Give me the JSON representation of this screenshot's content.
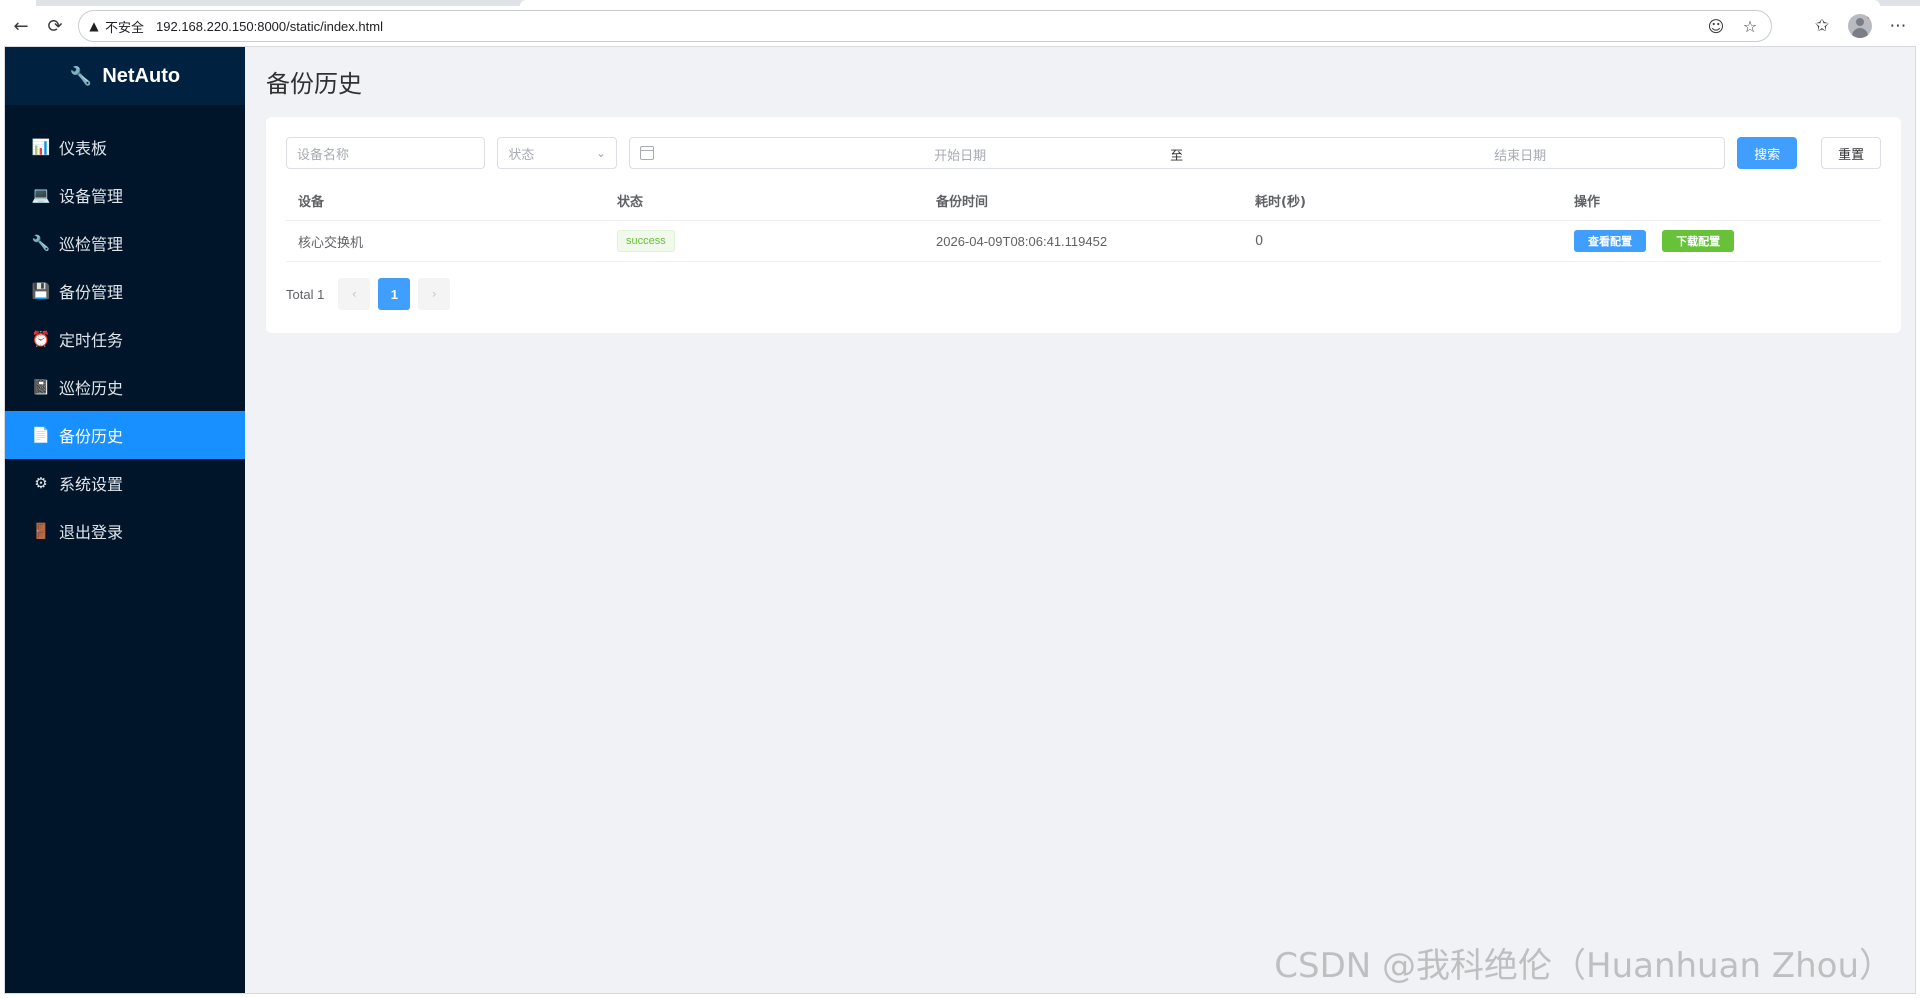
{
  "browser": {
    "insecure_label": "不安全",
    "url": "192.168.220.150:8000/static/index.html"
  },
  "sidebar": {
    "brand": "NetAuto",
    "items": [
      {
        "label": "仪表板",
        "icon": "dashboard-icon"
      },
      {
        "label": "设备管理",
        "icon": "monitor-icon"
      },
      {
        "label": "巡检管理",
        "icon": "wrench-icon"
      },
      {
        "label": "备份管理",
        "icon": "floppy-disk-icon"
      },
      {
        "label": "定时任务",
        "icon": "alarm-clock-icon"
      },
      {
        "label": "巡检历史",
        "icon": "notebook-icon"
      },
      {
        "label": "备份历史",
        "icon": "document-icon",
        "active": true
      },
      {
        "label": "系统设置",
        "icon": "gear-icon"
      },
      {
        "label": "退出登录",
        "icon": "door-icon"
      }
    ]
  },
  "page": {
    "title": "备份历史"
  },
  "filters": {
    "device_placeholder": "设备名称",
    "status_placeholder": "状态",
    "start_placeholder": "开始日期",
    "range_separator": "至",
    "end_placeholder": "结束日期",
    "search_label": "搜索",
    "reset_label": "重置"
  },
  "table": {
    "headers": [
      "设备",
      "状态",
      "备份时间",
      "耗时(秒)",
      "操作"
    ],
    "rows": [
      {
        "device": "核心交换机",
        "status": "success",
        "time": "2026-04-09T08:06:41.119452",
        "duration": "0",
        "view_label": "查看配置",
        "download_label": "下载配置"
      }
    ]
  },
  "pagination": {
    "total_label": "Total 1",
    "current_page": "1"
  },
  "watermark": "CSDN @我科绝伦（Huanhuan Zhou）",
  "colors": {
    "sidebar_bg": "#001529",
    "active_menu": "#1890ff",
    "primary": "#409eff",
    "success": "#67c23a"
  }
}
